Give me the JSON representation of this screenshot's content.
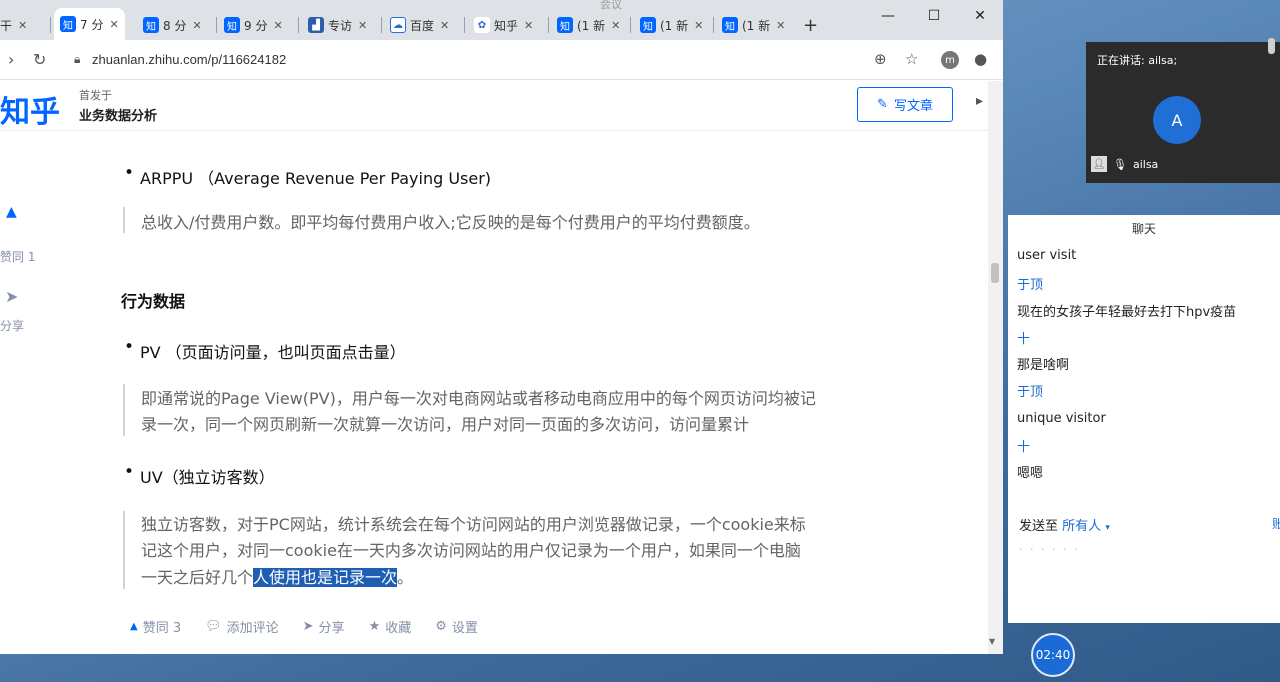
{
  "window_title_fragment": "会议",
  "tabs": [
    {
      "icon": "generic-tab-icon",
      "label": "干",
      "active": false
    },
    {
      "icon": "zhihu-icon",
      "label": "7 分",
      "active": true
    },
    {
      "icon": "zhihu-icon",
      "label": "8 分",
      "active": false
    },
    {
      "icon": "zhihu-icon",
      "label": "9 分",
      "active": false
    },
    {
      "icon": "chart-icon",
      "label": "专访",
      "active": false
    },
    {
      "icon": "cloud-icon",
      "label": "百度",
      "active": false
    },
    {
      "icon": "paw-icon",
      "label": "知乎",
      "active": false
    },
    {
      "icon": "zhihu-icon",
      "label": "(1 新",
      "active": false
    },
    {
      "icon": "zhihu-icon",
      "label": "(1 新",
      "active": false
    },
    {
      "icon": "zhihu-icon",
      "label": "(1 新",
      "active": false
    }
  ],
  "new_tab_label": "+",
  "window_controls": {
    "minimize": "—",
    "maximize": "☐",
    "close": "✕"
  },
  "address": {
    "url": "zhuanlan.zhihu.com/p/116624182",
    "avatar_letter": "m"
  },
  "header": {
    "logo": "知乎",
    "pub_label": "首发于",
    "pub_name": "业务数据分析",
    "write_button": "写文章"
  },
  "side": {
    "likes": "赞同 1",
    "share": "分享"
  },
  "article": {
    "arppu_bullet": "ARPPU （Average Revenue Per Paying User)",
    "arppu_quote": "总收入/付费用户数。即平均每付费用户收入;它反映的是每个付费用户的平均付费额度。",
    "section_heading": "行为数据",
    "pv_bullet": "PV （页面访问量，也叫页面点击量）",
    "pv_quote_line1": "即通常说的Page View(PV)，用户每一次对电商网站或者移动电商应用中的每个网页访问均被记",
    "pv_quote_line2": "录一次，同一个网页刷新一次就算一次访问，用户对同一页面的多次访问，访问量累计",
    "uv_bullet": "UV（独立访客数）",
    "uv_quote_line1": "独立访客数，对于PC网站，统计系统会在每个访问网站的用户浏览器做记录，一个cookie来标",
    "uv_quote_line2": "记这个用户，对同一cookie在一天内多次访问网站的用户仅记录为一个用户，如果同一个电脑",
    "uv_quote_line3_plain": "一天之后好几个",
    "uv_quote_line3_highlight": "人使用也是记录一次",
    "uv_quote_line3_end": "。"
  },
  "bottom_bar": {
    "likes": "赞同 3",
    "comment": "添加评论",
    "share": "分享",
    "favorite": "收藏",
    "settings": "设置"
  },
  "meeting": {
    "speaking": "正在讲话: ailsa;",
    "avatar_letter": "A",
    "user_name": "ailsa"
  },
  "chat": {
    "title": "聊天",
    "messages": [
      {
        "text": "user visit",
        "type": "body"
      },
      {
        "text": "于顶",
        "type": "name"
      },
      {
        "text": "现在的女孩子年轻最好去打下hpv疫苗",
        "type": "body"
      },
      {
        "text": "十",
        "type": "name"
      },
      {
        "text": "那是啥啊",
        "type": "body"
      },
      {
        "text": "于顶",
        "type": "name"
      },
      {
        "text": "unique  visitor",
        "type": "body"
      },
      {
        "text": "十",
        "type": "name"
      },
      {
        "text": "嗯嗯",
        "type": "body"
      }
    ],
    "send_to_label": "发送至",
    "send_to_target": "所有人",
    "input_hint": "· · · · · ·",
    "send_edge": "账"
  },
  "timer": "02:40",
  "colors": {
    "zhihu_blue": "#0066ff",
    "chat_blue": "#1a6bd6",
    "highlight": "#1e5fb4"
  }
}
